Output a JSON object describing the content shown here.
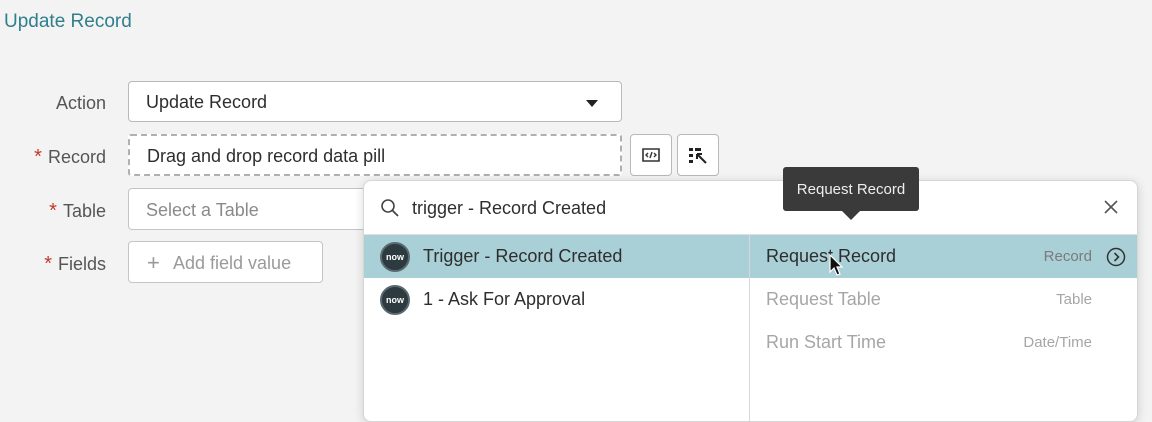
{
  "section": {
    "title": "Update Record"
  },
  "form": {
    "action_label": "Action",
    "action_value": "Update Record",
    "record_label": "Record",
    "record_placeholder": "Drag and drop record data pill",
    "table_label": "Table",
    "table_placeholder": "Select a Table",
    "fields_label": "Fields",
    "add_field_label": "Add field value",
    "required_mark": "*"
  },
  "picker": {
    "search_query": "trigger - Record Created",
    "steps": [
      {
        "badge": "now",
        "label": "Trigger - Record Created",
        "selected": true
      },
      {
        "badge": "now",
        "label": "1 - Ask For Approval",
        "selected": false
      }
    ],
    "fields": [
      {
        "name": "Request Record",
        "type": "Record",
        "selected": true
      },
      {
        "name": "Request Table",
        "type": "Table",
        "selected": false
      },
      {
        "name": "Run Start Time",
        "type": "Date/Time",
        "selected": false
      }
    ]
  },
  "tooltip": {
    "text": "Request Record"
  },
  "icons": {
    "script_toggle": "script-icon",
    "data_picker": "data-pill-picker-icon",
    "search": "search-icon",
    "close": "close-icon",
    "drilldown": "chevron-right-circle-icon"
  }
}
